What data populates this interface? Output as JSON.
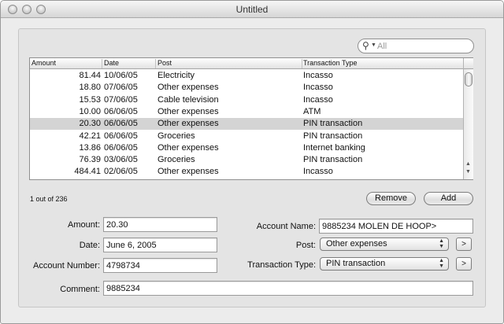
{
  "window": {
    "title": "Untitled"
  },
  "search": {
    "placeholder": "All",
    "icon": "magnifier-icon"
  },
  "table": {
    "columns": [
      "Amount",
      "Date",
      "Post",
      "Transaction Type"
    ],
    "rows": [
      [
        "81.44",
        "10/06/05",
        "Electricity",
        "Incasso"
      ],
      [
        "18.80",
        "07/06/05",
        "Other expenses",
        "Incasso"
      ],
      [
        "15.53",
        "07/06/05",
        "Cable television",
        "Incasso"
      ],
      [
        "10.00",
        "06/06/05",
        "Other expenses",
        "ATM"
      ],
      [
        "20.30",
        "06/06/05",
        "Other expenses",
        "PIN transaction"
      ],
      [
        "42.21",
        "06/06/05",
        "Groceries",
        "PIN transaction"
      ],
      [
        "13.86",
        "06/06/05",
        "Other expenses",
        "Internet banking"
      ],
      [
        "76.39",
        "03/06/05",
        "Groceries",
        "PIN transaction"
      ],
      [
        "484.41",
        "02/06/05",
        "Other expenses",
        "Incasso"
      ]
    ],
    "selected_row": 4
  },
  "status": {
    "record_count": "1 out of 236"
  },
  "buttons": {
    "remove": "Remove",
    "add": "Add",
    "post_go": ">",
    "type_go": ">"
  },
  "form": {
    "amount": {
      "label": "Amount:",
      "value": "20.30"
    },
    "date": {
      "label": "Date:",
      "value": "June 6, 2005"
    },
    "account_number": {
      "label": "Account Number:",
      "value": "4798734"
    },
    "account_name": {
      "label": "Account Name:",
      "value": "9885234 MOLEN DE HOOP>"
    },
    "post": {
      "label": "Post:",
      "value": "Other expenses"
    },
    "transaction_type": {
      "label": "Transaction Type:",
      "value": "PIN transaction"
    },
    "comment": {
      "label": "Comment:",
      "value": "9885234"
    }
  }
}
